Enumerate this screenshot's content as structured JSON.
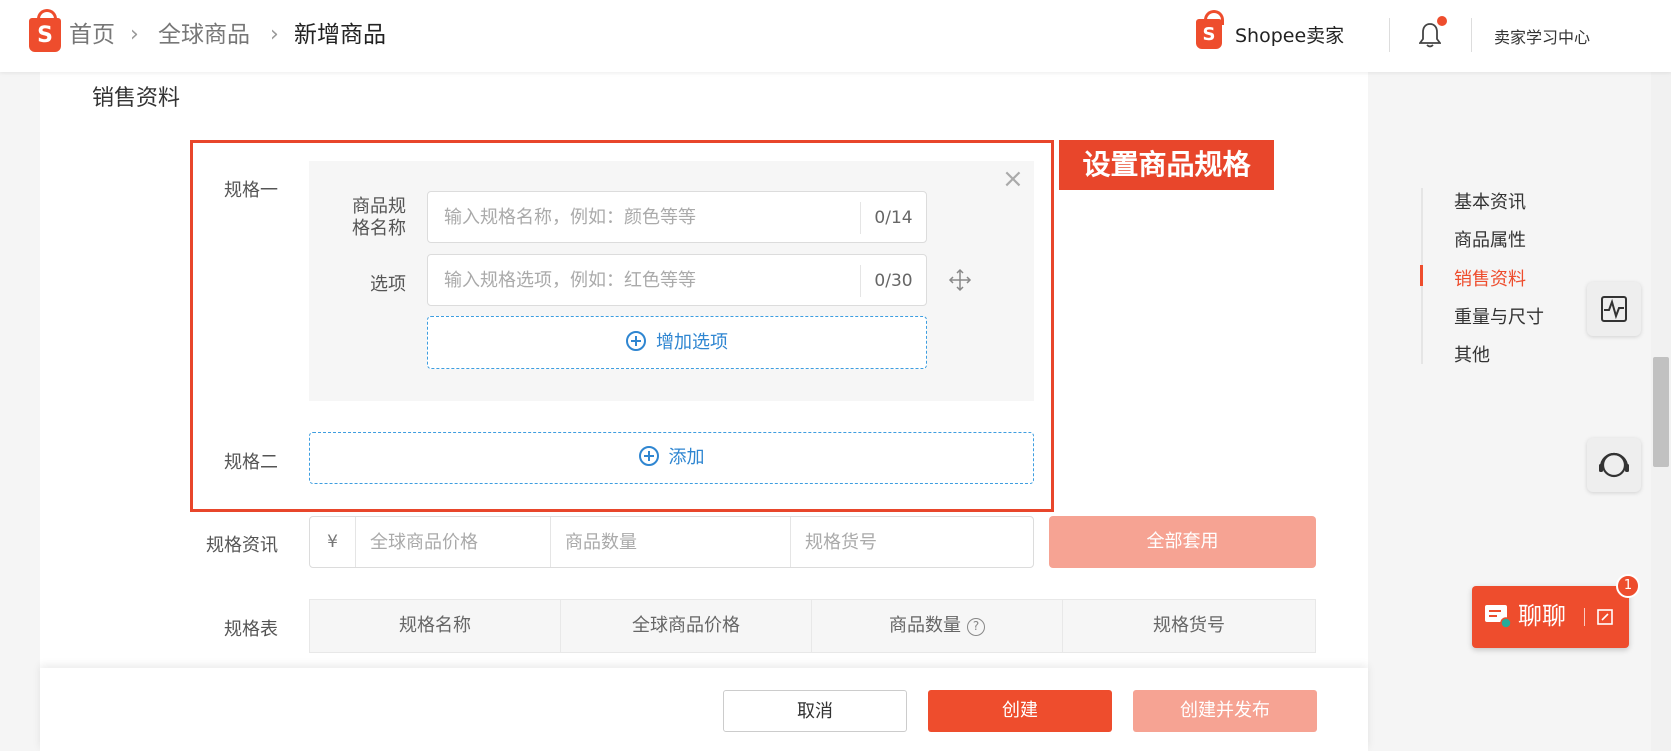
{
  "header": {
    "breadcrumb": [
      "首页",
      "全球商品",
      "新增商品"
    ],
    "brand_label": "Shopee卖家",
    "learning_center": "卖家学习中心"
  },
  "section_title": "销售资料",
  "callout": "设置商品规格",
  "spec1": {
    "label": "规格一",
    "name_label_line1": "商品规",
    "name_label_line2": "格名称",
    "name_placeholder": "输入规格名称，例如：颜色等等",
    "name_counter": "0/14",
    "option_label": "选项",
    "option_placeholder": "输入规格选项，例如：红色等等",
    "option_counter": "0/30",
    "add_option": "增加选项"
  },
  "spec2": {
    "label": "规格二",
    "add": "添加"
  },
  "spec_info": {
    "label": "规格资讯",
    "currency": "¥",
    "price_placeholder": "全球商品价格",
    "qty_placeholder": "商品数量",
    "sku_placeholder": "规格货号",
    "apply_all": "全部套用"
  },
  "spec_table": {
    "label": "规格表",
    "columns": [
      "规格名称",
      "全球商品价格",
      "商品数量",
      "规格货号"
    ]
  },
  "actions": {
    "cancel": "取消",
    "create": "创建",
    "create_publish": "创建并发布"
  },
  "side_nav": {
    "items": [
      "基本资讯",
      "商品属性",
      "销售资料",
      "重量与尺寸",
      "其他"
    ],
    "active_index": 2
  },
  "chat": {
    "label": "聊聊",
    "badge": "1"
  },
  "colors": {
    "brand": "#ee4d2d",
    "link_blue": "#2f86d1",
    "disabled_brand": "#f6a393"
  }
}
